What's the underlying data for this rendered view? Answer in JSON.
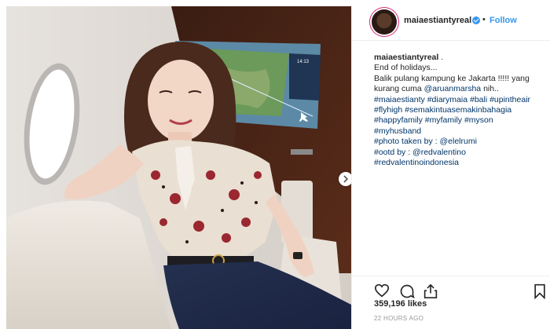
{
  "post": {
    "username": "maiaestiantyreal",
    "dot": "•",
    "follow_label": "Follow"
  },
  "caption": {
    "username": "maiaestiantyreal",
    "after_username": " .",
    "lines": [
      "End of holidays...",
      "Balik pulang kampung ke Jakarta !!!!! yang",
      "kurang cuma "
    ],
    "mention_1": "@aruanmarsha",
    "after_mention_1": " nih..",
    "hashtag_lines": [
      "#maiaestianty #diarymaia #bali #upintheair",
      "#flyhigh #semakintuasemakinbahagia",
      "#happyfamily #myfamily #myson",
      "#myhusband"
    ],
    "photo_label": "#photo taken by : ",
    "photo_credit": "@elelrumi",
    "ootd_label": "#ootd by : ",
    "ootd_credit": "@redvalentino",
    "last_tag": "#redvalentinoindonesia"
  },
  "stats": {
    "likes": "359,196 likes",
    "time": "22 HOURS AGO"
  },
  "screen": {
    "time": "14:13"
  },
  "icons": {
    "like": "heart-icon",
    "comment": "comment-icon",
    "share": "share-icon",
    "save": "bookmark-icon",
    "next": "chevron-right-icon",
    "verified": "verified-badge-icon"
  },
  "colors": {
    "link": "#003569",
    "follow": "#3897f0",
    "muted": "#999999"
  }
}
